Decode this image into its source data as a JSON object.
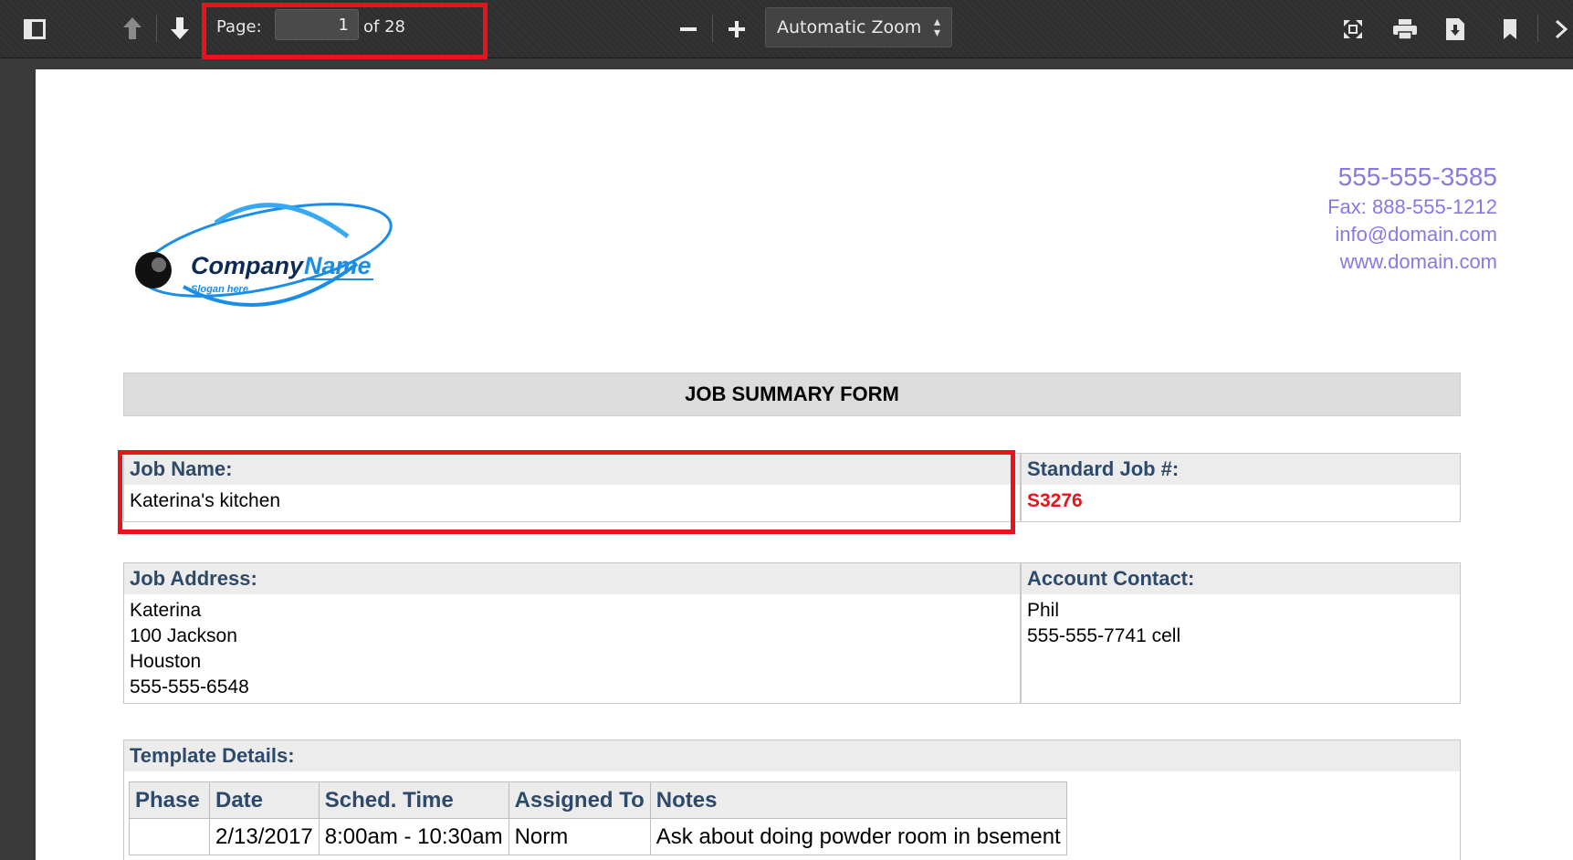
{
  "toolbar": {
    "page_label": "Page:",
    "page_value": "1",
    "page_of": "of 28",
    "zoom_value": "Automatic Zoom",
    "icons": [
      "sidebar-toggle-icon",
      "previous-page-icon",
      "next-page-icon",
      "zoom-out-icon",
      "zoom-in-icon",
      "presentation-mode-icon",
      "print-icon",
      "download-icon",
      "bookmark-icon",
      "more-tools-icon"
    ]
  },
  "document": {
    "logo": {
      "company": "Company",
      "name": "Name",
      "slogan": "Slogan here"
    },
    "contact": {
      "phone": "555-555-3585",
      "fax": "Fax: 888-555-1212",
      "email": "info@domain.com",
      "web": "www.domain.com"
    },
    "form_title": "JOB SUMMARY FORM",
    "job_name": {
      "label": "Job Name:",
      "value": "Katerina's kitchen"
    },
    "standard_job": {
      "label": "Standard Job #:",
      "value": "S3276"
    },
    "job_address": {
      "label": "Job Address:",
      "lines": [
        "Katerina",
        "100 Jackson",
        "Houston",
        "555-555-6548"
      ]
    },
    "account_contact": {
      "label": "Account Contact:",
      "lines": [
        "Phil",
        "555-555-7741 cell"
      ]
    },
    "template_details": {
      "label": "Template Details:",
      "columns": [
        "Phase",
        "Date",
        "Sched. Time",
        "Assigned To",
        "Notes"
      ],
      "rows": [
        [
          "",
          "2/13/2017",
          "8:00am - 10:30am",
          "Norm",
          "Ask about doing powder room in bsement"
        ]
      ]
    }
  },
  "colors": {
    "highlight": "#e8141c",
    "contact_text": "#8a78e0",
    "header_text": "#2e4a6a",
    "job_number": "#e8141c"
  }
}
